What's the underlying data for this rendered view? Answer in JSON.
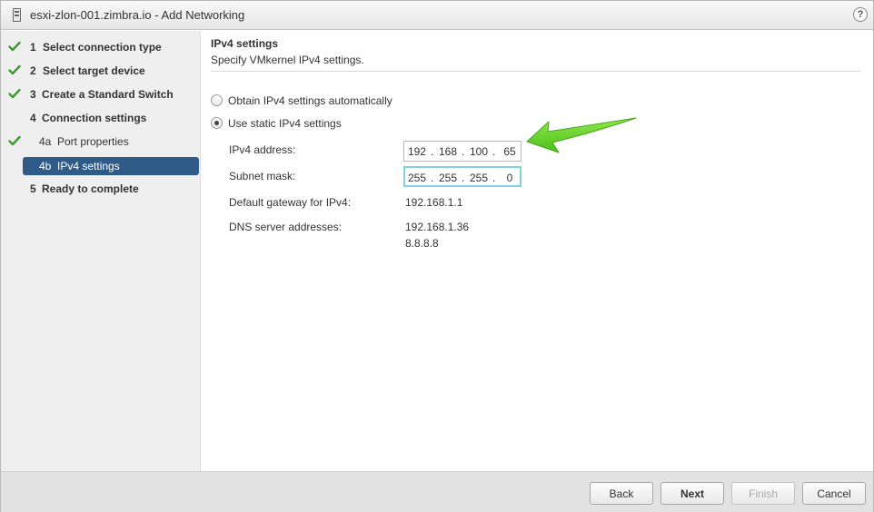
{
  "window": {
    "title": "esxi-zlon-001.zimbra.io - Add Networking",
    "help_label": "?"
  },
  "nav": {
    "items": [
      {
        "num": "1",
        "label": "Select connection type",
        "done": true
      },
      {
        "num": "2",
        "label": "Select target device",
        "done": true
      },
      {
        "num": "3",
        "label": "Create a Standard Switch",
        "done": true
      },
      {
        "num": "4",
        "label": "Connection settings",
        "done": false
      },
      {
        "num": "4a",
        "label": "Port properties",
        "done": true
      },
      {
        "num": "4b",
        "label": "IPv4 settings",
        "done": false,
        "active": true
      },
      {
        "num": "5",
        "label": "Ready to complete",
        "done": false
      }
    ]
  },
  "content": {
    "title": "IPv4 settings",
    "subtitle": "Specify VMkernel IPv4 settings.",
    "options": [
      {
        "label": "Obtain IPv4 settings automatically",
        "checked": false
      },
      {
        "label": "Use static IPv4 settings",
        "checked": true
      }
    ],
    "fields": {
      "ipv4_label": "IPv4 address:",
      "ipv4_octets": [
        "192",
        "168",
        "100",
        "65"
      ],
      "subnet_label": "Subnet mask:",
      "subnet_octets": [
        "255",
        "255",
        "255",
        "0"
      ],
      "gateway_label": "Default gateway for IPv4:",
      "gateway_value": "192.168.1.1",
      "dns_label": "DNS server addresses:",
      "dns_values": [
        "192.168.1.36",
        "8.8.8.8"
      ]
    },
    "separator": "."
  },
  "footer": {
    "back_label": "Back",
    "next_label": "Next",
    "finish_label": "Finish",
    "cancel_label": "Cancel"
  },
  "colors": {
    "check": "#3d9a2e",
    "active_nav": "#2e5b87",
    "focus_border": "#7fd3e0",
    "arrow": "#6ad32a"
  },
  "icons": {
    "title": "host-icon",
    "help": "help-icon",
    "check": "checkmark-icon",
    "annotation": "green-arrow-icon"
  }
}
